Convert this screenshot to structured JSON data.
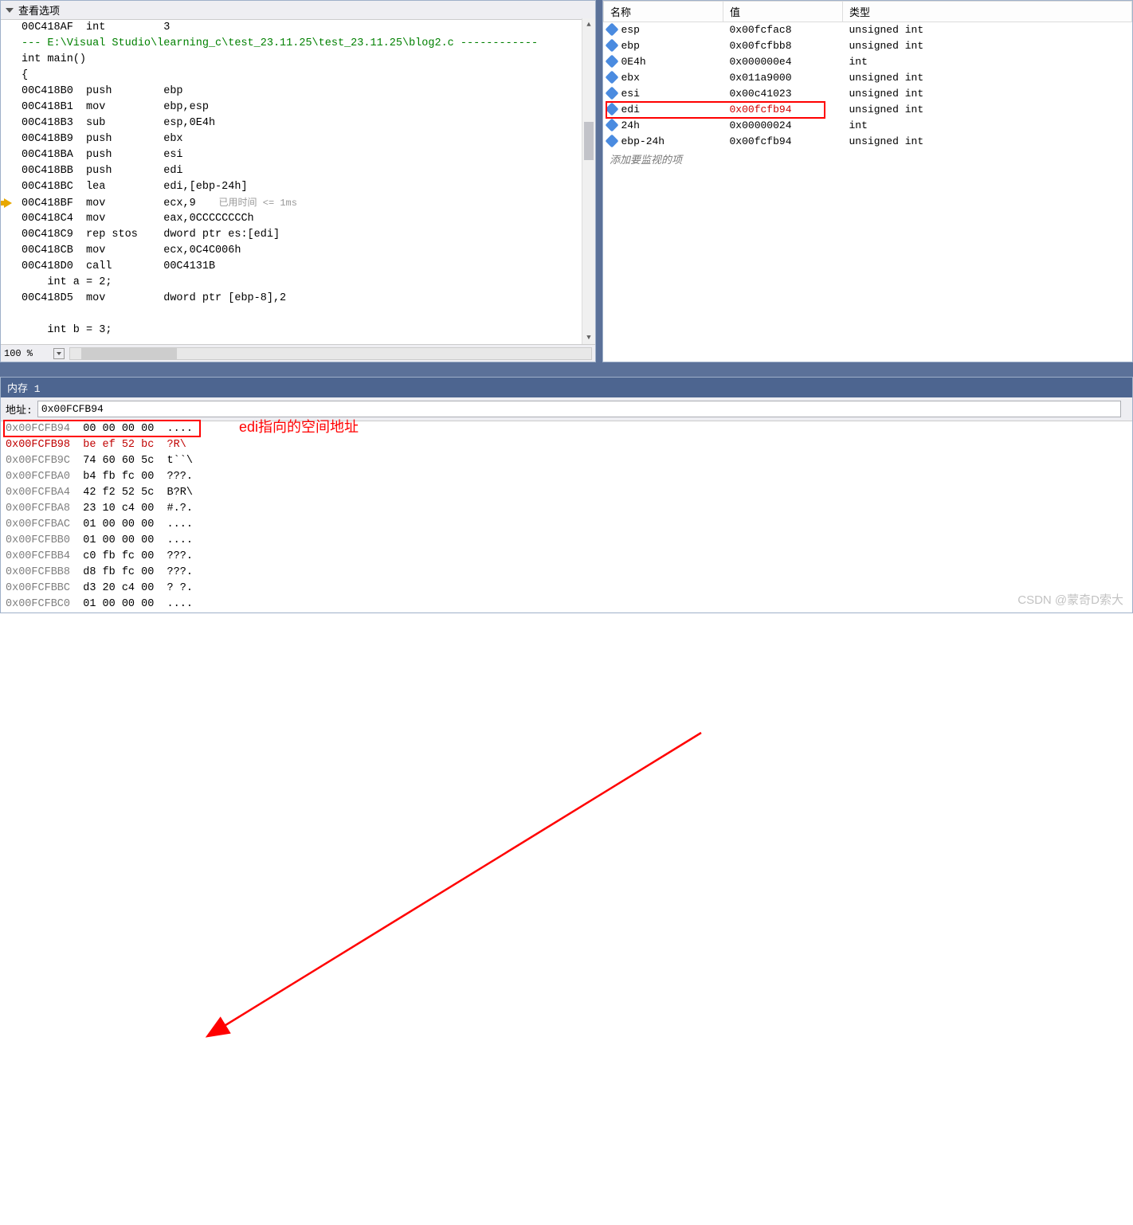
{
  "disasm": {
    "header": "查看选项",
    "zoom": "100 %",
    "lines": [
      {
        "addr": "00C418AF",
        "mnem": "int",
        "op": "3"
      },
      {
        "comment": "--- E:\\Visual Studio\\learning_c\\test_23.11.25\\test_23.11.25\\blog2.c ------------"
      },
      {
        "src": "int main()"
      },
      {
        "src": "{"
      },
      {
        "addr": "00C418B0",
        "mnem": "push",
        "op": "ebp"
      },
      {
        "addr": "00C418B1",
        "mnem": "mov",
        "op": "ebp,esp"
      },
      {
        "addr": "00C418B3",
        "mnem": "sub",
        "op": "esp,0E4h"
      },
      {
        "addr": "00C418B9",
        "mnem": "push",
        "op": "ebx"
      },
      {
        "addr": "00C418BA",
        "mnem": "push",
        "op": "esi"
      },
      {
        "addr": "00C418BB",
        "mnem": "push",
        "op": "edi"
      },
      {
        "addr": "00C418BC",
        "mnem": "lea",
        "op": "edi,[ebp-24h]"
      },
      {
        "addr": "00C418BF",
        "mnem": "mov",
        "op": "ecx,9",
        "cur": true,
        "timing": "已用时间 <= 1ms"
      },
      {
        "addr": "00C418C4",
        "mnem": "mov",
        "op": "eax,0CCCCCCCCh"
      },
      {
        "addr": "00C418C9",
        "mnem": "rep stos",
        "op": "dword ptr es:[edi]"
      },
      {
        "addr": "00C418CB",
        "mnem": "mov",
        "op": "ecx,0C4C006h"
      },
      {
        "addr": "00C418D0",
        "mnem": "call",
        "op": "00C4131B"
      },
      {
        "src": "    int a = 2;"
      },
      {
        "addr": "00C418D5",
        "mnem": "mov",
        "op": "dword ptr [ebp-8],2"
      },
      {
        "src": ""
      },
      {
        "src": "    int b = 3;"
      }
    ]
  },
  "watch": {
    "cols": [
      "名称",
      "值",
      "类型"
    ],
    "rows": [
      {
        "n": "esp",
        "v": "0x00fcfac8",
        "t": "unsigned int"
      },
      {
        "n": "ebp",
        "v": "0x00fcfbb8",
        "t": "unsigned int"
      },
      {
        "n": "0E4h",
        "v": "0x000000e4",
        "t": "int"
      },
      {
        "n": "ebx",
        "v": "0x011a9000",
        "t": "unsigned int"
      },
      {
        "n": "esi",
        "v": "0x00c41023",
        "t": "unsigned int"
      },
      {
        "n": "edi",
        "v": "0x00fcfb94",
        "t": "unsigned int",
        "hl": true
      },
      {
        "n": "24h",
        "v": "0x00000024",
        "t": "int"
      },
      {
        "n": "ebp-24h",
        "v": "0x00fcfb94",
        "t": "unsigned int"
      }
    ],
    "add": "添加要监视的项"
  },
  "memory": {
    "title": "内存 1",
    "addr_label": "地址:",
    "addr_value": "0x00FCFB94",
    "rows": [
      {
        "a": "0x00FCFB94",
        "b": "00 00 00 00",
        "s": "....",
        "hl": true
      },
      {
        "a": "0x00FCFB98",
        "b": "be ef 52 bc",
        "s": "?R\\",
        "red": true
      },
      {
        "a": "0x00FCFB9C",
        "b": "74 60 60 5c",
        "s": "t``\\"
      },
      {
        "a": "0x00FCFBA0",
        "b": "b4 fb fc 00",
        "s": "???."
      },
      {
        "a": "0x00FCFBA4",
        "b": "42 f2 52 5c",
        "s": "B?R\\"
      },
      {
        "a": "0x00FCFBA8",
        "b": "23 10 c4 00",
        "s": "#.?."
      },
      {
        "a": "0x00FCFBAC",
        "b": "01 00 00 00",
        "s": "...."
      },
      {
        "a": "0x00FCFBB0",
        "b": "01 00 00 00",
        "s": "...."
      },
      {
        "a": "0x00FCFBB4",
        "b": "c0 fb fc 00",
        "s": "???."
      },
      {
        "a": "0x00FCFBB8",
        "b": "d8 fb fc 00",
        "s": "???."
      },
      {
        "a": "0x00FCFBBC",
        "b": "d3 20 c4 00",
        "s": "? ?."
      },
      {
        "a": "0x00FCFBC0",
        "b": "01 00 00 00",
        "s": "...."
      }
    ]
  },
  "annotation": "edi指向的空间地址",
  "watermark": "CSDN @蒙奇D索大"
}
